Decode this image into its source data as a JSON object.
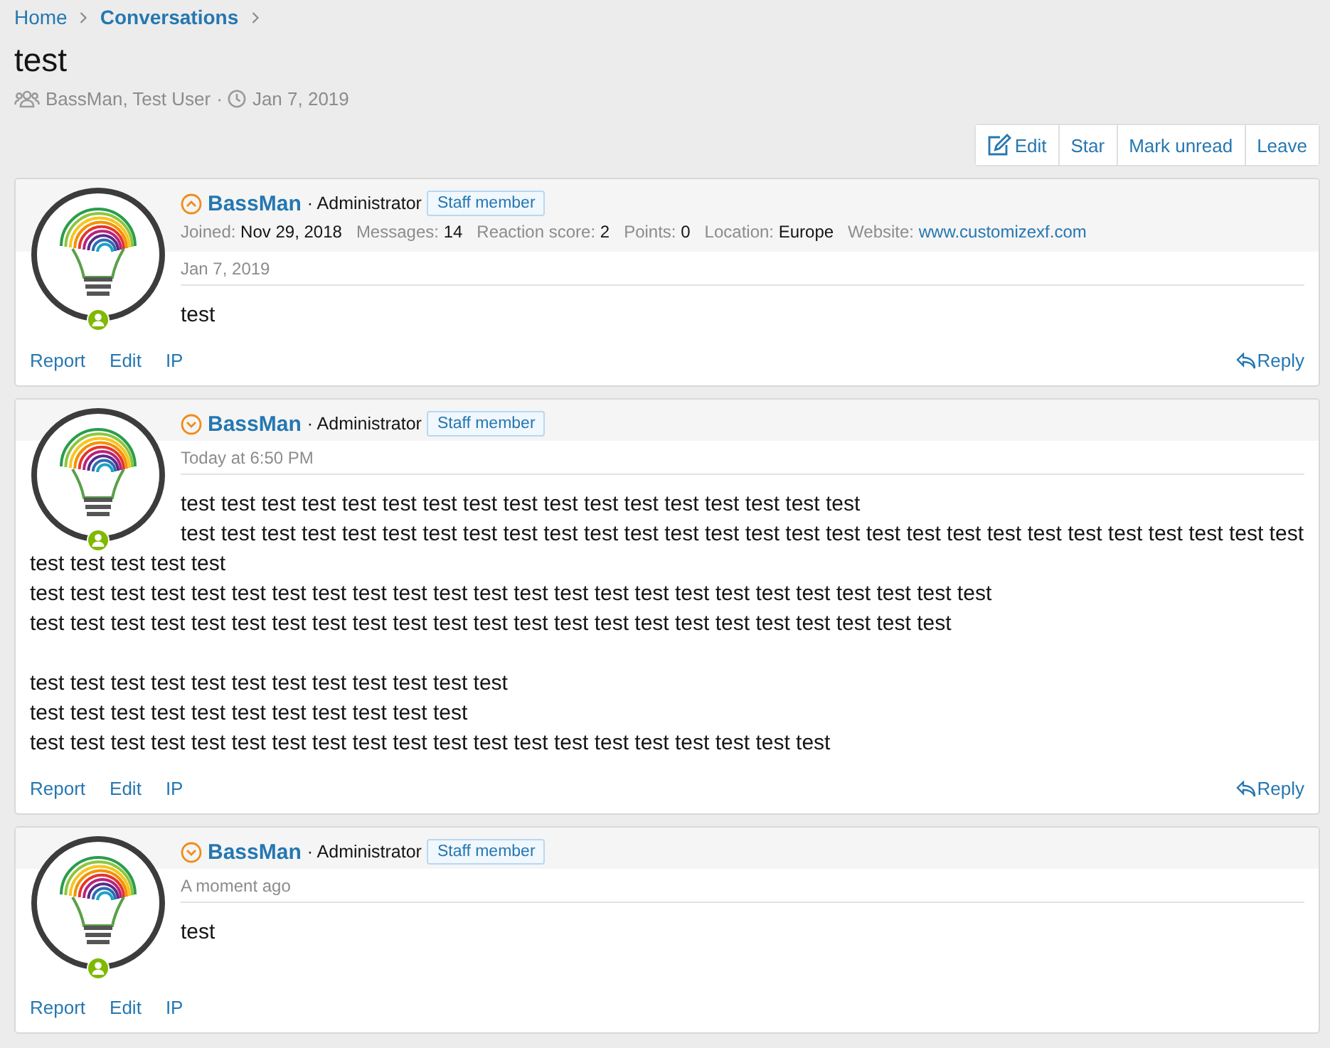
{
  "breadcrumb": [
    {
      "label": "Home",
      "current": false
    },
    {
      "label": "Conversations",
      "current": true
    }
  ],
  "title": "test",
  "meta": {
    "participants": "BassMan, Test User",
    "separator": "·",
    "date": "Jan 7, 2019"
  },
  "actions": [
    {
      "label": "Edit",
      "kind": "icon"
    },
    {
      "label": "Star",
      "kind": "text"
    },
    {
      "label": "Mark unread",
      "kind": "text"
    },
    {
      "label": "Leave",
      "kind": "text"
    }
  ],
  "messages": [
    {
      "author": "BassMan",
      "role": "· Administrator",
      "badge": "Staff member",
      "expanded": true,
      "online": true,
      "details": [
        {
          "label": "Joined:",
          "value": "Nov 29, 2018",
          "kind": "text"
        },
        {
          "label": "Messages:",
          "value": "14",
          "kind": "text"
        },
        {
          "label": "Reaction score:",
          "value": "2",
          "kind": "text"
        },
        {
          "label": "Points:",
          "value": "0",
          "kind": "text"
        },
        {
          "label": "Location:",
          "value": "Europe",
          "kind": "text"
        },
        {
          "label": "Website:",
          "value": "www.customizexf.com",
          "kind": "link"
        }
      ],
      "date": "Jan 7, 2019",
      "paragraphs": [
        [
          "test"
        ]
      ],
      "links": [
        "Report",
        "Edit",
        "IP"
      ],
      "reply": "Reply"
    },
    {
      "author": "BassMan",
      "role": "· Administrator",
      "badge": "Staff member",
      "expanded": false,
      "online": true,
      "date": "Today at 6:50 PM",
      "paragraphs": [
        [
          "test test test test test test test test test test test test test test test test test",
          "test test test test test test test test test test test test test test test test test test test test test test test test test test test test test test test test test",
          "test test test test test test test test test test test test test test test test test test test test test test test test",
          "test test test test test test test test test test test test test test test test test test test test test test test"
        ],
        [
          "test test test test test test test test test test test test",
          "test test test test test test test test test test test",
          "test test test test test test test test test test test test test test test test test test test test"
        ]
      ],
      "links": [
        "Report",
        "Edit",
        "IP"
      ],
      "reply": "Reply"
    },
    {
      "author": "BassMan",
      "role": "· Administrator",
      "badge": "Staff member",
      "expanded": false,
      "online": true,
      "date": "A moment ago",
      "paragraphs": [
        [
          "test"
        ]
      ],
      "links": [
        "Report",
        "Edit",
        "IP"
      ]
    }
  ]
}
